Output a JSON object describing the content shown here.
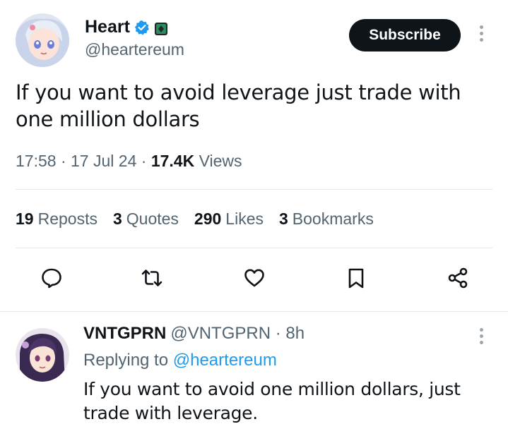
{
  "tweet": {
    "author_name": "Heart",
    "author_handle": "@heartereum",
    "subscribe_label": "Subscribe",
    "text": "If you want to avoid leverage just trade with one million dollars",
    "time": "17:58",
    "date": "17 Jul 24",
    "views_count": "17.4K",
    "views_label": "Views",
    "separator": "·"
  },
  "stats": {
    "reposts_count": "19",
    "reposts_label": "Reposts",
    "quotes_count": "3",
    "quotes_label": "Quotes",
    "likes_count": "290",
    "likes_label": "Likes",
    "bookmarks_count": "3",
    "bookmarks_label": "Bookmarks"
  },
  "actions": [
    "reply-icon",
    "repost-icon",
    "like-icon",
    "bookmark-icon",
    "share-icon"
  ],
  "reply": {
    "author_name": "VNTGPRN",
    "author_handle": "@VNTGPRN",
    "separator": "·",
    "time": "8h",
    "replying_label": "Replying to",
    "replying_to": "@heartereum",
    "text": "If you want to avoid one million dollars, just trade with leverage."
  },
  "colors": {
    "text_primary": "#0f1419",
    "text_secondary": "#536471",
    "link": "#1d9bf0",
    "verified": "#1d9bf0",
    "button_bg": "#0f1419"
  }
}
